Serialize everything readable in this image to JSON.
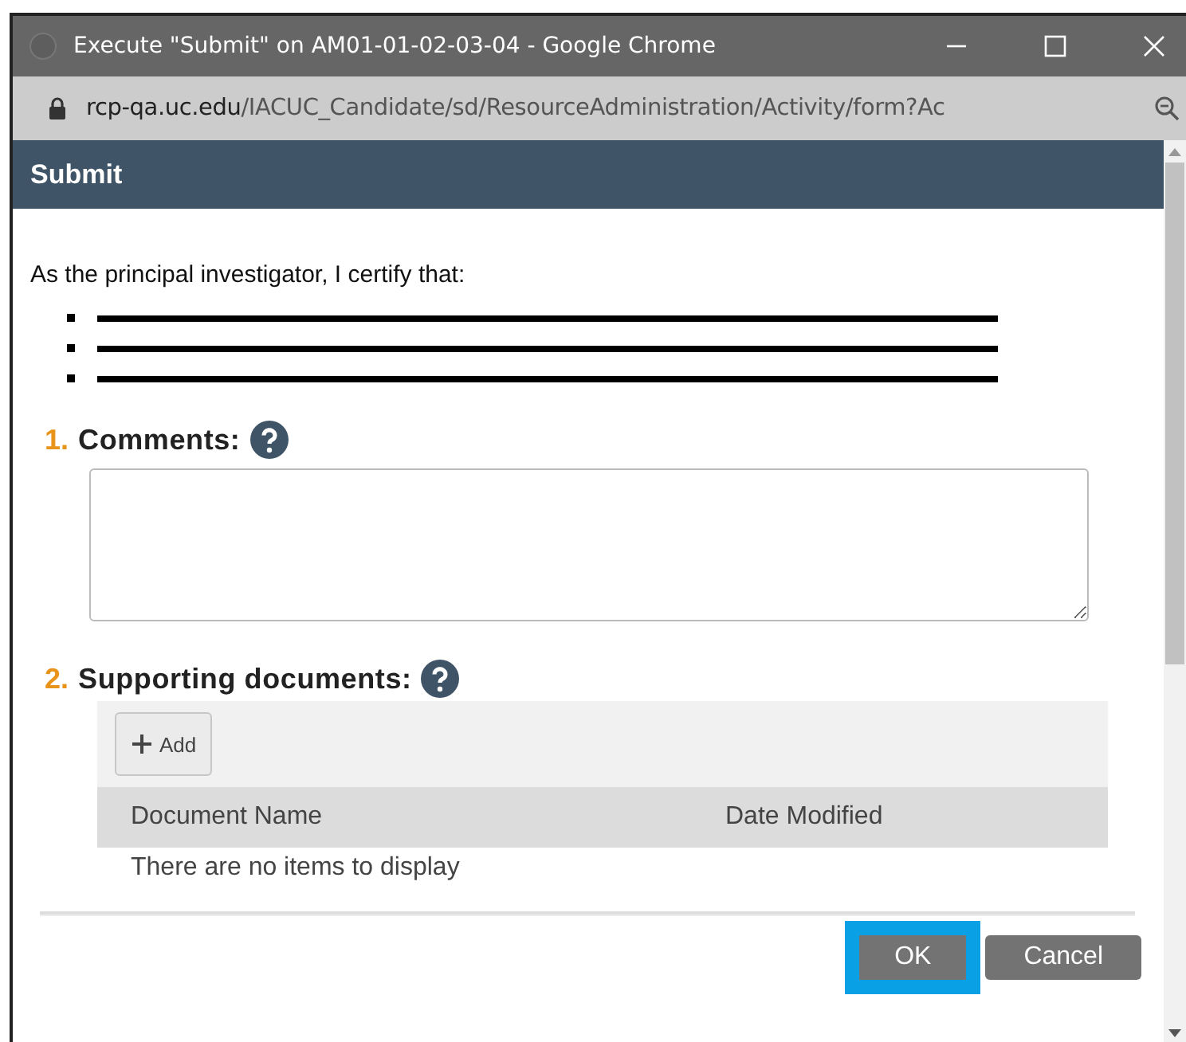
{
  "window": {
    "title": "Execute \"Submit\" on AM01-01-02-03-04 - Google Chrome"
  },
  "address_bar": {
    "domain": "rcp-qa.uc.edu",
    "path": "/IACUC_Candidate/sd/ResourceAdministration/Activity/form?Ac"
  },
  "dialog": {
    "title": "Submit"
  },
  "intro": "As the principal investigator, I certify that:",
  "certifications": [
    {
      "redacted": true
    },
    {
      "redacted": true
    },
    {
      "redacted": true
    }
  ],
  "questions": [
    {
      "number": "1.",
      "label": "Comments:",
      "kind": "textarea"
    },
    {
      "number": "2.",
      "label": "Supporting documents:",
      "kind": "documents",
      "add_button": "Add",
      "columns": [
        "Document Name",
        "Date Modified"
      ],
      "empty_text": "There are no items to display"
    }
  ],
  "buttons": [
    {
      "label": "OK",
      "focused": true
    },
    {
      "label": "Cancel",
      "focused": false
    }
  ]
}
